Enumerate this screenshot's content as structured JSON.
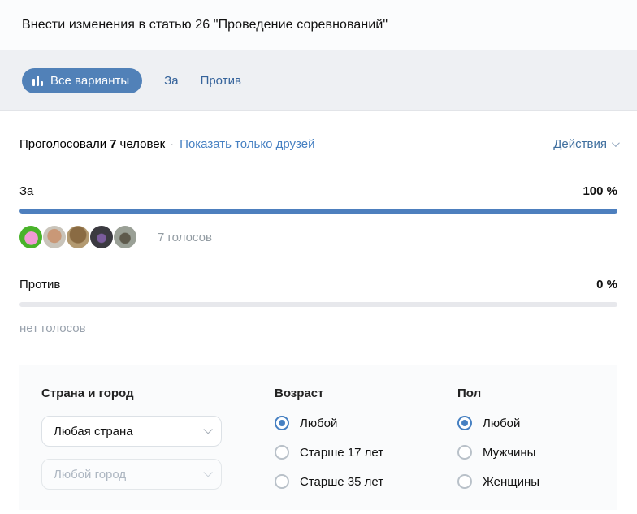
{
  "poll": {
    "title": "Внести изменения в статью 26 \"Проведение соревнований\"",
    "tabs": {
      "all_label": "Все варианты",
      "for_label": "За",
      "against_label": "Против"
    },
    "meta": {
      "voted_prefix": "Проголосовали",
      "voted_count": "7",
      "voted_suffix": "человек",
      "separator": "·",
      "show_friends_label": "Показать только друзей",
      "actions_label": "Действия"
    },
    "options": [
      {
        "label": "За",
        "percent_text": "100 %",
        "percent_value": 100,
        "votes_text": "7 голосов"
      },
      {
        "label": "Против",
        "percent_text": "0 %",
        "percent_value": 0,
        "votes_text": "нет голосов"
      }
    ],
    "voters": {
      "avatars": [
        "avatar-pink-cartoon",
        "avatar-gray-haired-man",
        "avatar-brown-photo",
        "avatar-purple-figure",
        "avatar-gray-scene"
      ]
    }
  },
  "filters": {
    "country_city": {
      "title": "Страна и город",
      "country_value": "Любая страна",
      "city_placeholder": "Любой город"
    },
    "age": {
      "title": "Возраст",
      "options": [
        {
          "label": "Любой",
          "selected": true
        },
        {
          "label": "Старше 17 лет",
          "selected": false
        },
        {
          "label": "Старше 35 лет",
          "selected": false
        }
      ]
    },
    "gender": {
      "title": "Пол",
      "options": [
        {
          "label": "Любой",
          "selected": true
        },
        {
          "label": "Мужчины",
          "selected": false
        },
        {
          "label": "Женщины",
          "selected": false
        }
      ]
    }
  },
  "colors": {
    "accent_blue": "#5181b8",
    "bar_blue": "#4d7fbe",
    "bar_empty": "#e7e8ec",
    "link_blue": "#4680c2",
    "tab_strip_bg": "#eef0f3"
  }
}
